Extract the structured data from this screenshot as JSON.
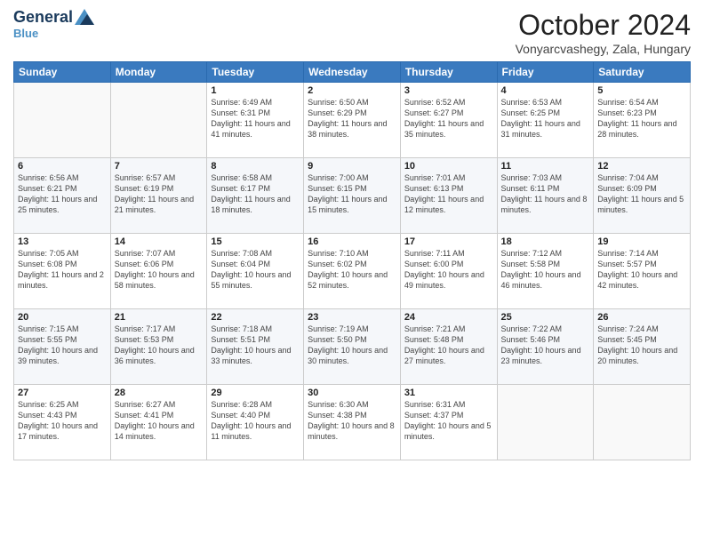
{
  "logo": {
    "general": "General",
    "blue": "Blue",
    "tagline": "Blue"
  },
  "header": {
    "title": "October 2024",
    "subtitle": "Vonyarcvashegy, Zala, Hungary"
  },
  "days_of_week": [
    "Sunday",
    "Monday",
    "Tuesday",
    "Wednesday",
    "Thursday",
    "Friday",
    "Saturday"
  ],
  "weeks": [
    [
      {
        "day": "",
        "sunrise": "",
        "sunset": "",
        "daylight": ""
      },
      {
        "day": "",
        "sunrise": "",
        "sunset": "",
        "daylight": ""
      },
      {
        "day": "1",
        "sunrise": "Sunrise: 6:49 AM",
        "sunset": "Sunset: 6:31 PM",
        "daylight": "Daylight: 11 hours and 41 minutes."
      },
      {
        "day": "2",
        "sunrise": "Sunrise: 6:50 AM",
        "sunset": "Sunset: 6:29 PM",
        "daylight": "Daylight: 11 hours and 38 minutes."
      },
      {
        "day": "3",
        "sunrise": "Sunrise: 6:52 AM",
        "sunset": "Sunset: 6:27 PM",
        "daylight": "Daylight: 11 hours and 35 minutes."
      },
      {
        "day": "4",
        "sunrise": "Sunrise: 6:53 AM",
        "sunset": "Sunset: 6:25 PM",
        "daylight": "Daylight: 11 hours and 31 minutes."
      },
      {
        "day": "5",
        "sunrise": "Sunrise: 6:54 AM",
        "sunset": "Sunset: 6:23 PM",
        "daylight": "Daylight: 11 hours and 28 minutes."
      }
    ],
    [
      {
        "day": "6",
        "sunrise": "Sunrise: 6:56 AM",
        "sunset": "Sunset: 6:21 PM",
        "daylight": "Daylight: 11 hours and 25 minutes."
      },
      {
        "day": "7",
        "sunrise": "Sunrise: 6:57 AM",
        "sunset": "Sunset: 6:19 PM",
        "daylight": "Daylight: 11 hours and 21 minutes."
      },
      {
        "day": "8",
        "sunrise": "Sunrise: 6:58 AM",
        "sunset": "Sunset: 6:17 PM",
        "daylight": "Daylight: 11 hours and 18 minutes."
      },
      {
        "day": "9",
        "sunrise": "Sunrise: 7:00 AM",
        "sunset": "Sunset: 6:15 PM",
        "daylight": "Daylight: 11 hours and 15 minutes."
      },
      {
        "day": "10",
        "sunrise": "Sunrise: 7:01 AM",
        "sunset": "Sunset: 6:13 PM",
        "daylight": "Daylight: 11 hours and 12 minutes."
      },
      {
        "day": "11",
        "sunrise": "Sunrise: 7:03 AM",
        "sunset": "Sunset: 6:11 PM",
        "daylight": "Daylight: 11 hours and 8 minutes."
      },
      {
        "day": "12",
        "sunrise": "Sunrise: 7:04 AM",
        "sunset": "Sunset: 6:09 PM",
        "daylight": "Daylight: 11 hours and 5 minutes."
      }
    ],
    [
      {
        "day": "13",
        "sunrise": "Sunrise: 7:05 AM",
        "sunset": "Sunset: 6:08 PM",
        "daylight": "Daylight: 11 hours and 2 minutes."
      },
      {
        "day": "14",
        "sunrise": "Sunrise: 7:07 AM",
        "sunset": "Sunset: 6:06 PM",
        "daylight": "Daylight: 10 hours and 58 minutes."
      },
      {
        "day": "15",
        "sunrise": "Sunrise: 7:08 AM",
        "sunset": "Sunset: 6:04 PM",
        "daylight": "Daylight: 10 hours and 55 minutes."
      },
      {
        "day": "16",
        "sunrise": "Sunrise: 7:10 AM",
        "sunset": "Sunset: 6:02 PM",
        "daylight": "Daylight: 10 hours and 52 minutes."
      },
      {
        "day": "17",
        "sunrise": "Sunrise: 7:11 AM",
        "sunset": "Sunset: 6:00 PM",
        "daylight": "Daylight: 10 hours and 49 minutes."
      },
      {
        "day": "18",
        "sunrise": "Sunrise: 7:12 AM",
        "sunset": "Sunset: 5:58 PM",
        "daylight": "Daylight: 10 hours and 46 minutes."
      },
      {
        "day": "19",
        "sunrise": "Sunrise: 7:14 AM",
        "sunset": "Sunset: 5:57 PM",
        "daylight": "Daylight: 10 hours and 42 minutes."
      }
    ],
    [
      {
        "day": "20",
        "sunrise": "Sunrise: 7:15 AM",
        "sunset": "Sunset: 5:55 PM",
        "daylight": "Daylight: 10 hours and 39 minutes."
      },
      {
        "day": "21",
        "sunrise": "Sunrise: 7:17 AM",
        "sunset": "Sunset: 5:53 PM",
        "daylight": "Daylight: 10 hours and 36 minutes."
      },
      {
        "day": "22",
        "sunrise": "Sunrise: 7:18 AM",
        "sunset": "Sunset: 5:51 PM",
        "daylight": "Daylight: 10 hours and 33 minutes."
      },
      {
        "day": "23",
        "sunrise": "Sunrise: 7:19 AM",
        "sunset": "Sunset: 5:50 PM",
        "daylight": "Daylight: 10 hours and 30 minutes."
      },
      {
        "day": "24",
        "sunrise": "Sunrise: 7:21 AM",
        "sunset": "Sunset: 5:48 PM",
        "daylight": "Daylight: 10 hours and 27 minutes."
      },
      {
        "day": "25",
        "sunrise": "Sunrise: 7:22 AM",
        "sunset": "Sunset: 5:46 PM",
        "daylight": "Daylight: 10 hours and 23 minutes."
      },
      {
        "day": "26",
        "sunrise": "Sunrise: 7:24 AM",
        "sunset": "Sunset: 5:45 PM",
        "daylight": "Daylight: 10 hours and 20 minutes."
      }
    ],
    [
      {
        "day": "27",
        "sunrise": "Sunrise: 6:25 AM",
        "sunset": "Sunset: 4:43 PM",
        "daylight": "Daylight: 10 hours and 17 minutes."
      },
      {
        "day": "28",
        "sunrise": "Sunrise: 6:27 AM",
        "sunset": "Sunset: 4:41 PM",
        "daylight": "Daylight: 10 hours and 14 minutes."
      },
      {
        "day": "29",
        "sunrise": "Sunrise: 6:28 AM",
        "sunset": "Sunset: 4:40 PM",
        "daylight": "Daylight: 10 hours and 11 minutes."
      },
      {
        "day": "30",
        "sunrise": "Sunrise: 6:30 AM",
        "sunset": "Sunset: 4:38 PM",
        "daylight": "Daylight: 10 hours and 8 minutes."
      },
      {
        "day": "31",
        "sunrise": "Sunrise: 6:31 AM",
        "sunset": "Sunset: 4:37 PM",
        "daylight": "Daylight: 10 hours and 5 minutes."
      },
      {
        "day": "",
        "sunrise": "",
        "sunset": "",
        "daylight": ""
      },
      {
        "day": "",
        "sunrise": "",
        "sunset": "",
        "daylight": ""
      }
    ]
  ]
}
